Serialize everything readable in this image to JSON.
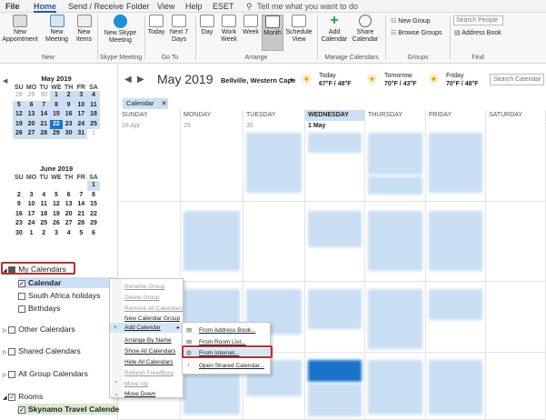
{
  "menubar": {
    "tabs": [
      "File",
      "Home",
      "Send / Receive",
      "Folder",
      "View",
      "Help",
      "ESET"
    ],
    "tell_me": "Tell me what you want to do"
  },
  "ribbon": {
    "new_appointment": "New\nAppointment",
    "new_meeting": "New\nMeeting",
    "new_items": "New\nItems",
    "group_new": "New",
    "new_skype": "New Skype\nMeeting",
    "group_skype": "Skype Meeting",
    "today": "Today",
    "next7": "Next 7\nDays",
    "group_goto": "Go To",
    "day": "Day",
    "work_week": "Work\nWeek",
    "week": "Week",
    "month": "Month",
    "schedule_view": "Schedule\nView",
    "group_arrange": "Arrange",
    "add_calendar": "Add\nCalendar",
    "share_calendar": "Share\nCalendar",
    "group_manage": "Manage Calendars",
    "new_group": "New Group",
    "browse_groups": "Browse Groups",
    "group_groups": "Groups",
    "search_people": "Search People",
    "address_book": "Address Book",
    "group_find": "Find"
  },
  "datebar": {
    "month_label": "May 2019",
    "location": "Bellville, Western Cape",
    "weather": [
      {
        "day": "Today",
        "temp": "67°F / 48°F"
      },
      {
        "day": "Tomorrow",
        "temp": "70°F / 43°F"
      },
      {
        "day": "Friday",
        "temp": "70°F / 48°F"
      }
    ],
    "search_placeholder": "Search Calendar"
  },
  "calendar": {
    "tab_label": "Calendar",
    "days": [
      "SUNDAY",
      "MONDAY",
      "TUESDAY",
      "WEDNESDAY",
      "THURSDAY",
      "FRIDAY",
      "SATURDAY"
    ],
    "first_cell_label": "28 Apr",
    "first_row_nums": [
      "29",
      "30",
      "1 May"
    ]
  },
  "mini_may": {
    "title": "May 2019",
    "head": [
      "SU",
      "MO",
      "TU",
      "WE",
      "TH",
      "FR",
      "SA"
    ],
    "rows": [
      [
        "28",
        "29",
        "30",
        "1",
        "2",
        "3",
        "4"
      ],
      [
        "5",
        "6",
        "7",
        "8",
        "9",
        "10",
        "11"
      ],
      [
        "12",
        "13",
        "14",
        "15",
        "16",
        "17",
        "18"
      ],
      [
        "19",
        "20",
        "21",
        "22",
        "23",
        "24",
        "25"
      ],
      [
        "26",
        "27",
        "28",
        "29",
        "30",
        "31",
        "1"
      ]
    ]
  },
  "mini_june": {
    "title": "June 2019",
    "head": [
      "SU",
      "MO",
      "TU",
      "WE",
      "TH",
      "FR",
      "SA"
    ],
    "rows": [
      [
        "",
        "",
        "",
        "",
        "",
        "",
        "1"
      ],
      [
        "2",
        "3",
        "4",
        "5",
        "6",
        "7",
        "8"
      ],
      [
        "9",
        "10",
        "11",
        "12",
        "13",
        "14",
        "15"
      ],
      [
        "16",
        "17",
        "18",
        "19",
        "20",
        "21",
        "22"
      ],
      [
        "23",
        "24",
        "25",
        "26",
        "27",
        "28",
        "29"
      ],
      [
        "30",
        "1",
        "2",
        "3",
        "4",
        "5",
        "6"
      ]
    ]
  },
  "folders": {
    "my_calendars": "My Calendars",
    "calendar": "Calendar",
    "sa_holidays": "South Africa holidays",
    "birthdays": "Birthdays",
    "other_calendars": "Other Calendars",
    "shared_calendars": "Shared Calendars",
    "all_group_calendars": "All Group Calendars",
    "rooms": "Rooms",
    "skynamo": "Skynamo Travel Calender"
  },
  "context_menu": {
    "items": [
      "Rename Group",
      "Delete Group",
      "Remove All Calendars",
      "New Calendar Group",
      "Add Calendar",
      "Arrange By Name",
      "Show All Calendars",
      "Hide All Calendars",
      "Refresh Free/Busy",
      "Move Up",
      "Move Down"
    ]
  },
  "submenu": {
    "items": [
      "From Address Book...",
      "From Room List...",
      "From Internet...",
      "Open Shared Calendar..."
    ]
  },
  "colors": {
    "accent": "#2b579a",
    "event": "#c9def3",
    "today": "#1a73c8",
    "highlight": "#b7322f"
  }
}
